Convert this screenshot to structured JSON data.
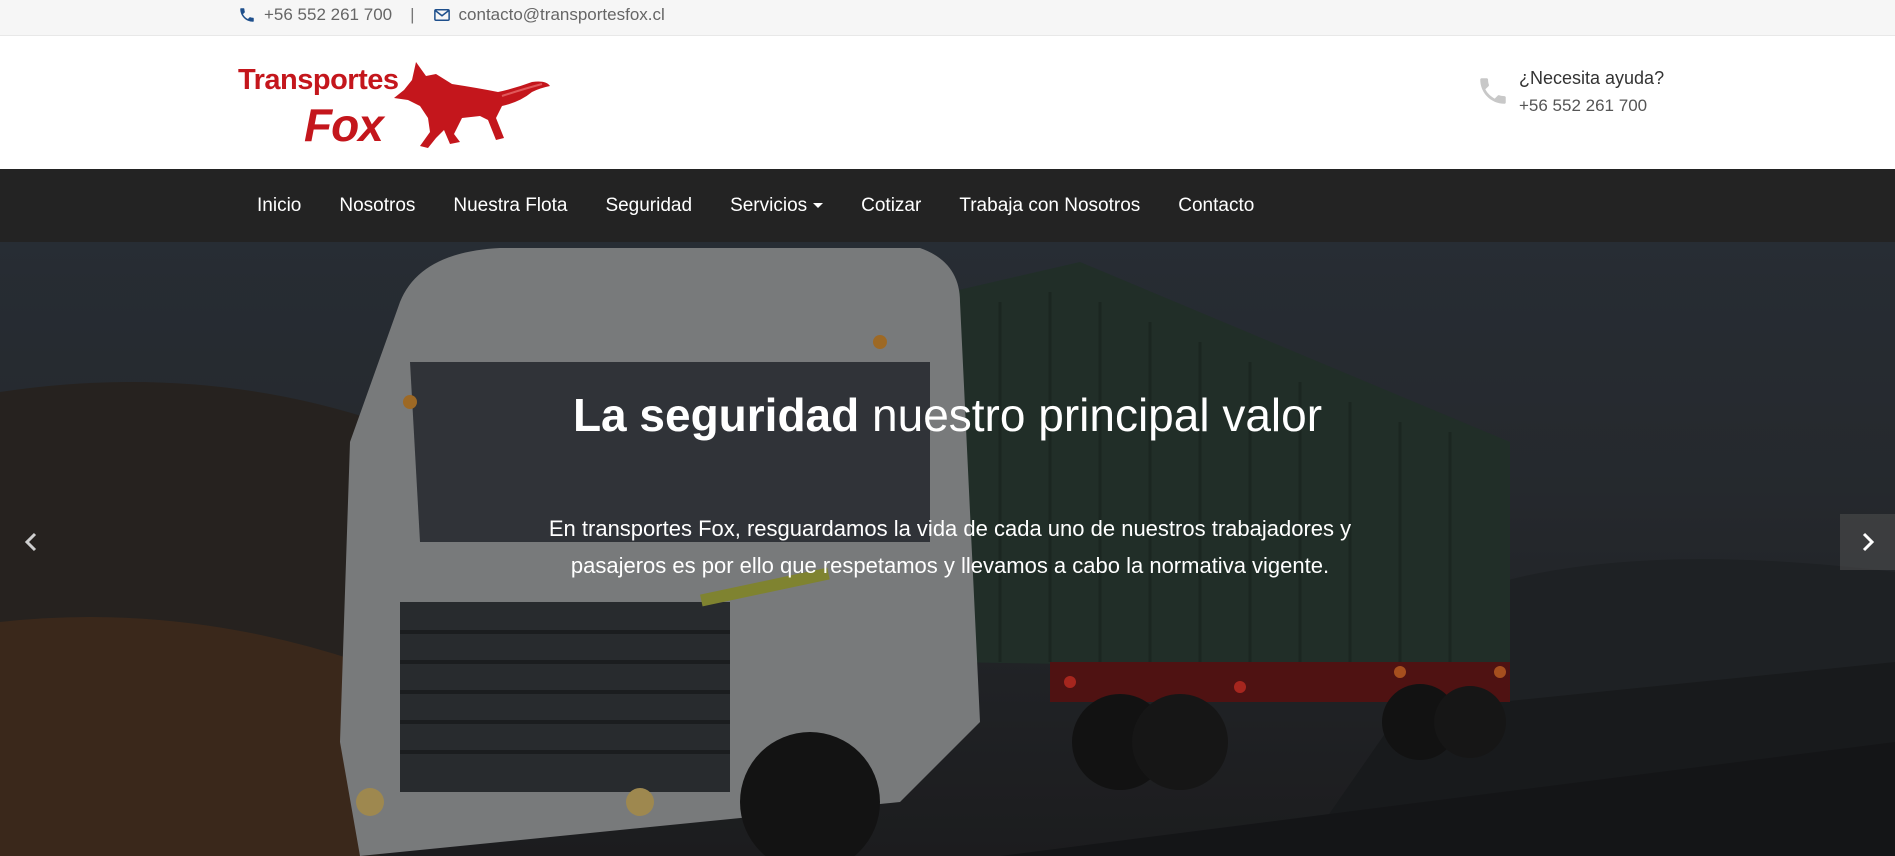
{
  "topbar": {
    "phone": "+56 552 261 700",
    "separator": "|",
    "email": "contacto@transportesfox.cl"
  },
  "logo": {
    "line1": "Transportes",
    "line2": "Fox"
  },
  "help": {
    "title": "¿Necesita ayuda?",
    "phone": "+56 552 261 700"
  },
  "nav": {
    "items": [
      {
        "label": "Inicio"
      },
      {
        "label": "Nosotros"
      },
      {
        "label": "Nuestra Flota"
      },
      {
        "label": "Seguridad"
      },
      {
        "label": "Servicios"
      },
      {
        "label": "Cotizar"
      },
      {
        "label": "Trabaja con Nosotros"
      },
      {
        "label": "Contacto"
      }
    ]
  },
  "hero": {
    "title_bold": "La seguridad",
    "title_rest": " nuestro principal valor",
    "text": "En transportes Fox, resguardamos la vida de cada uno de nuestros trabajadores y pasajeros es por ello que respetamos y llevamos a cabo la normativa vigente."
  },
  "colors": {
    "brand_red": "#c4161c",
    "nav_bg": "#232323",
    "topbar_bg": "#f6f6f6"
  },
  "icons": {
    "phone": "phone-icon",
    "email": "envelope-icon",
    "help_phone": "phone-icon",
    "prev": "chevron-left-icon",
    "next": "chevron-right-icon"
  }
}
